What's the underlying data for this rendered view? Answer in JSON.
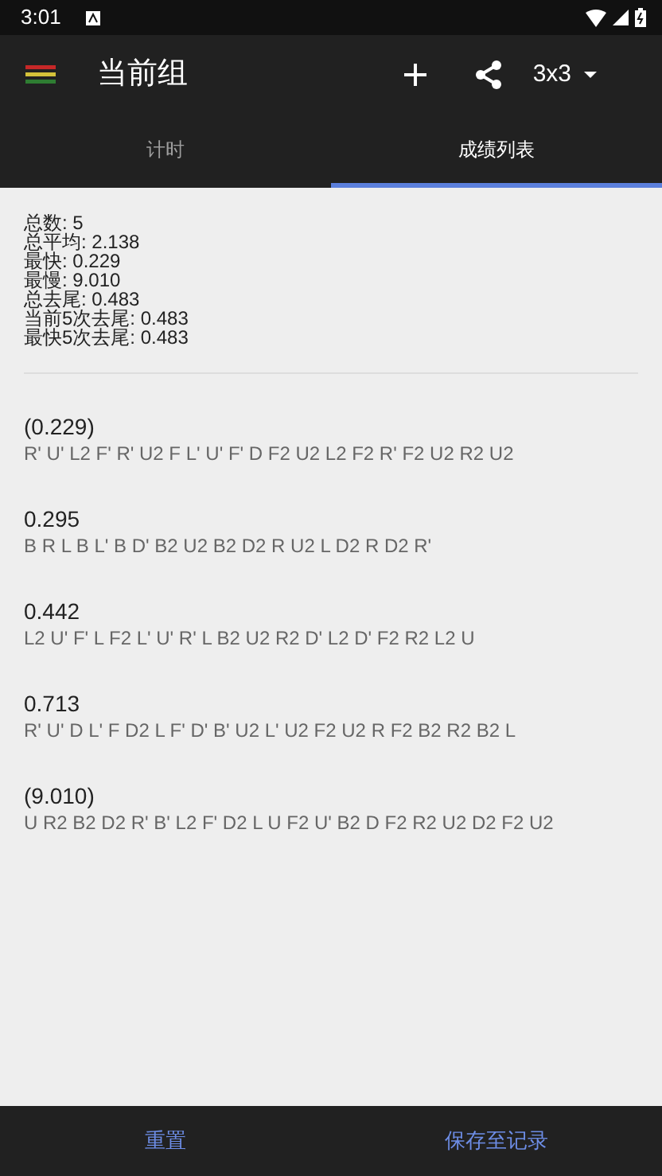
{
  "status_bar": {
    "time": "3:01"
  },
  "app_bar": {
    "title": "当前组",
    "puzzle": "3x3"
  },
  "tabs": [
    {
      "label": "计时",
      "selected": false
    },
    {
      "label": "成绩列表",
      "selected": true
    }
  ],
  "stats": [
    "总数: 5",
    "总平均: 2.138",
    "最快: 0.229",
    "最慢: 9.010",
    "总去尾: 0.483",
    "当前5次去尾: 0.483",
    "最快5次去尾: 0.483"
  ],
  "results": [
    {
      "time": "(0.229)",
      "scramble": "R' U' L2 F' R' U2 F L' U' F' D F2 U2 L2 F2 R' F2 U2 R2 U2"
    },
    {
      "time": "0.295",
      "scramble": "B R L B L' B D' B2 U2 B2 D2 R U2 L D2 R D2 R'"
    },
    {
      "time": "0.442",
      "scramble": "L2 U' F' L F2 L' U' R' L B2 U2 R2 D' L2 D' F2 R2 L2 U"
    },
    {
      "time": "0.713",
      "scramble": "R' U' D L' F D2 L F' D' B' U2 L' U2 F2 U2 R F2 B2 R2 B2 L"
    },
    {
      "time": "(9.010)",
      "scramble": "U R2 B2 D2 R' B' L2 F' D2 L U F2 U' B2 D F2 R2 U2 D2 F2 U2"
    }
  ],
  "buttons": [
    "重置",
    "保存至记录"
  ]
}
